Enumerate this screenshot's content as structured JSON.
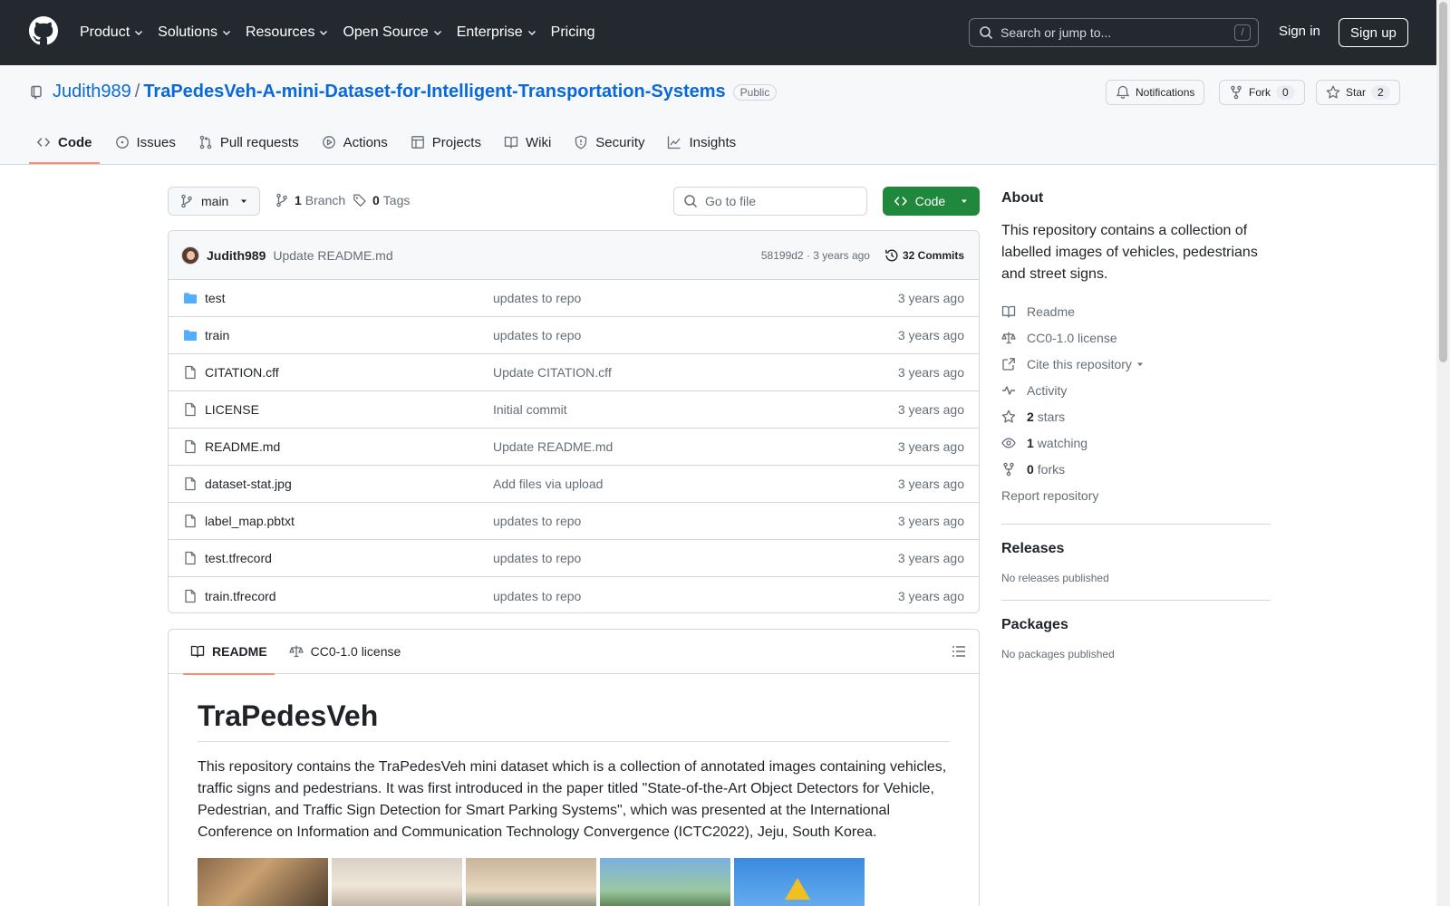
{
  "header": {
    "nav": [
      {
        "label": "Product",
        "caret": true
      },
      {
        "label": "Solutions",
        "caret": true
      },
      {
        "label": "Resources",
        "caret": true
      },
      {
        "label": "Open Source",
        "caret": true
      },
      {
        "label": "Enterprise",
        "caret": true
      },
      {
        "label": "Pricing",
        "caret": false
      }
    ],
    "search_placeholder": "Search or jump to...",
    "search_shortcut": "/",
    "sign_in": "Sign in",
    "sign_up": "Sign up"
  },
  "repo": {
    "owner": "Judith989",
    "separator": "/",
    "name": "TraPedesVeh-A-mini-Dataset-for-Intelligent-Transportation-Systems",
    "visibility": "Public",
    "notifications_label": "Notifications",
    "fork_label": "Fork",
    "fork_count": "0",
    "star_label": "Star",
    "star_count": "2"
  },
  "tabs": [
    {
      "label": "Code",
      "icon": "code-icon",
      "active": true
    },
    {
      "label": "Issues",
      "icon": "issue-icon",
      "active": false
    },
    {
      "label": "Pull requests",
      "icon": "pull-request-icon",
      "active": false
    },
    {
      "label": "Actions",
      "icon": "play-icon",
      "active": false
    },
    {
      "label": "Projects",
      "icon": "table-icon",
      "active": false
    },
    {
      "label": "Wiki",
      "icon": "book-icon",
      "active": false
    },
    {
      "label": "Security",
      "icon": "shield-icon",
      "active": false
    },
    {
      "label": "Insights",
      "icon": "graph-icon",
      "active": false
    }
  ],
  "toolbar": {
    "branch": "main",
    "branch_count": "1",
    "branch_label": "Branch",
    "tag_count": "0",
    "tag_label": "Tags",
    "goto_placeholder": "Go to file",
    "code_label": "Code"
  },
  "commit": {
    "author": "Judith989",
    "message": "Update README.md",
    "meta": "58199d2 · 3 years ago",
    "count_label": "32 Commits"
  },
  "files": [
    {
      "name": "test",
      "type": "folder",
      "message": "updates to repo",
      "date": "3 years ago"
    },
    {
      "name": "train",
      "type": "folder",
      "message": "updates to repo",
      "date": "3 years ago"
    },
    {
      "name": "CITATION.cff",
      "type": "file",
      "message": "Update CITATION.cff",
      "date": "3 years ago"
    },
    {
      "name": "LICENSE",
      "type": "file",
      "message": "Initial commit",
      "date": "3 years ago"
    },
    {
      "name": "README.md",
      "type": "file",
      "message": "Update README.md",
      "date": "3 years ago"
    },
    {
      "name": "dataset-stat.jpg",
      "type": "file",
      "message": "Add files via upload",
      "date": "3 years ago"
    },
    {
      "name": "label_map.pbtxt",
      "type": "file",
      "message": "updates to repo",
      "date": "3 years ago"
    },
    {
      "name": "test.tfrecord",
      "type": "file",
      "message": "updates to repo",
      "date": "3 years ago"
    },
    {
      "name": "train.tfrecord",
      "type": "file",
      "message": "updates to repo",
      "date": "3 years ago"
    }
  ],
  "readme": {
    "tab_readme": "README",
    "tab_license": "CC0-1.0 license",
    "title": "TraPedesVeh",
    "paragraph": "This repository contains the TraPedesVeh mini dataset which is a collection of annotated images containing vehicles, traffic signs and pedestrians. It was first introduced in the paper titled \"State-of-the-Art Object Detectors for Vehicle, Pedestrian, and Traffic Sign Detection for Smart Parking Systems\", which was presented at the International Conference on Information and Communication Technology Convergence (ICTC2022), Jeju, South Korea."
  },
  "sidebar": {
    "about_title": "About",
    "about_text": "This repository contains a collection of labelled images of vehicles, pedestrians and street signs.",
    "readme": "Readme",
    "license": "CC0-1.0 license",
    "cite": "Cite this repository",
    "activity": "Activity",
    "stars_count": "2",
    "stars_label": "stars",
    "watching_count": "1",
    "watching_label": "watching",
    "forks_count": "0",
    "forks_label": "forks",
    "report": "Report repository",
    "releases_title": "Releases",
    "releases_text": "No releases published",
    "packages_title": "Packages",
    "packages_text": "No packages published"
  },
  "colors": {
    "header_bg": "#24292f",
    "link": "#0969da",
    "primary_button": "#1f883d",
    "active_tab": "#fd8c73",
    "folder": "#54aeff"
  }
}
